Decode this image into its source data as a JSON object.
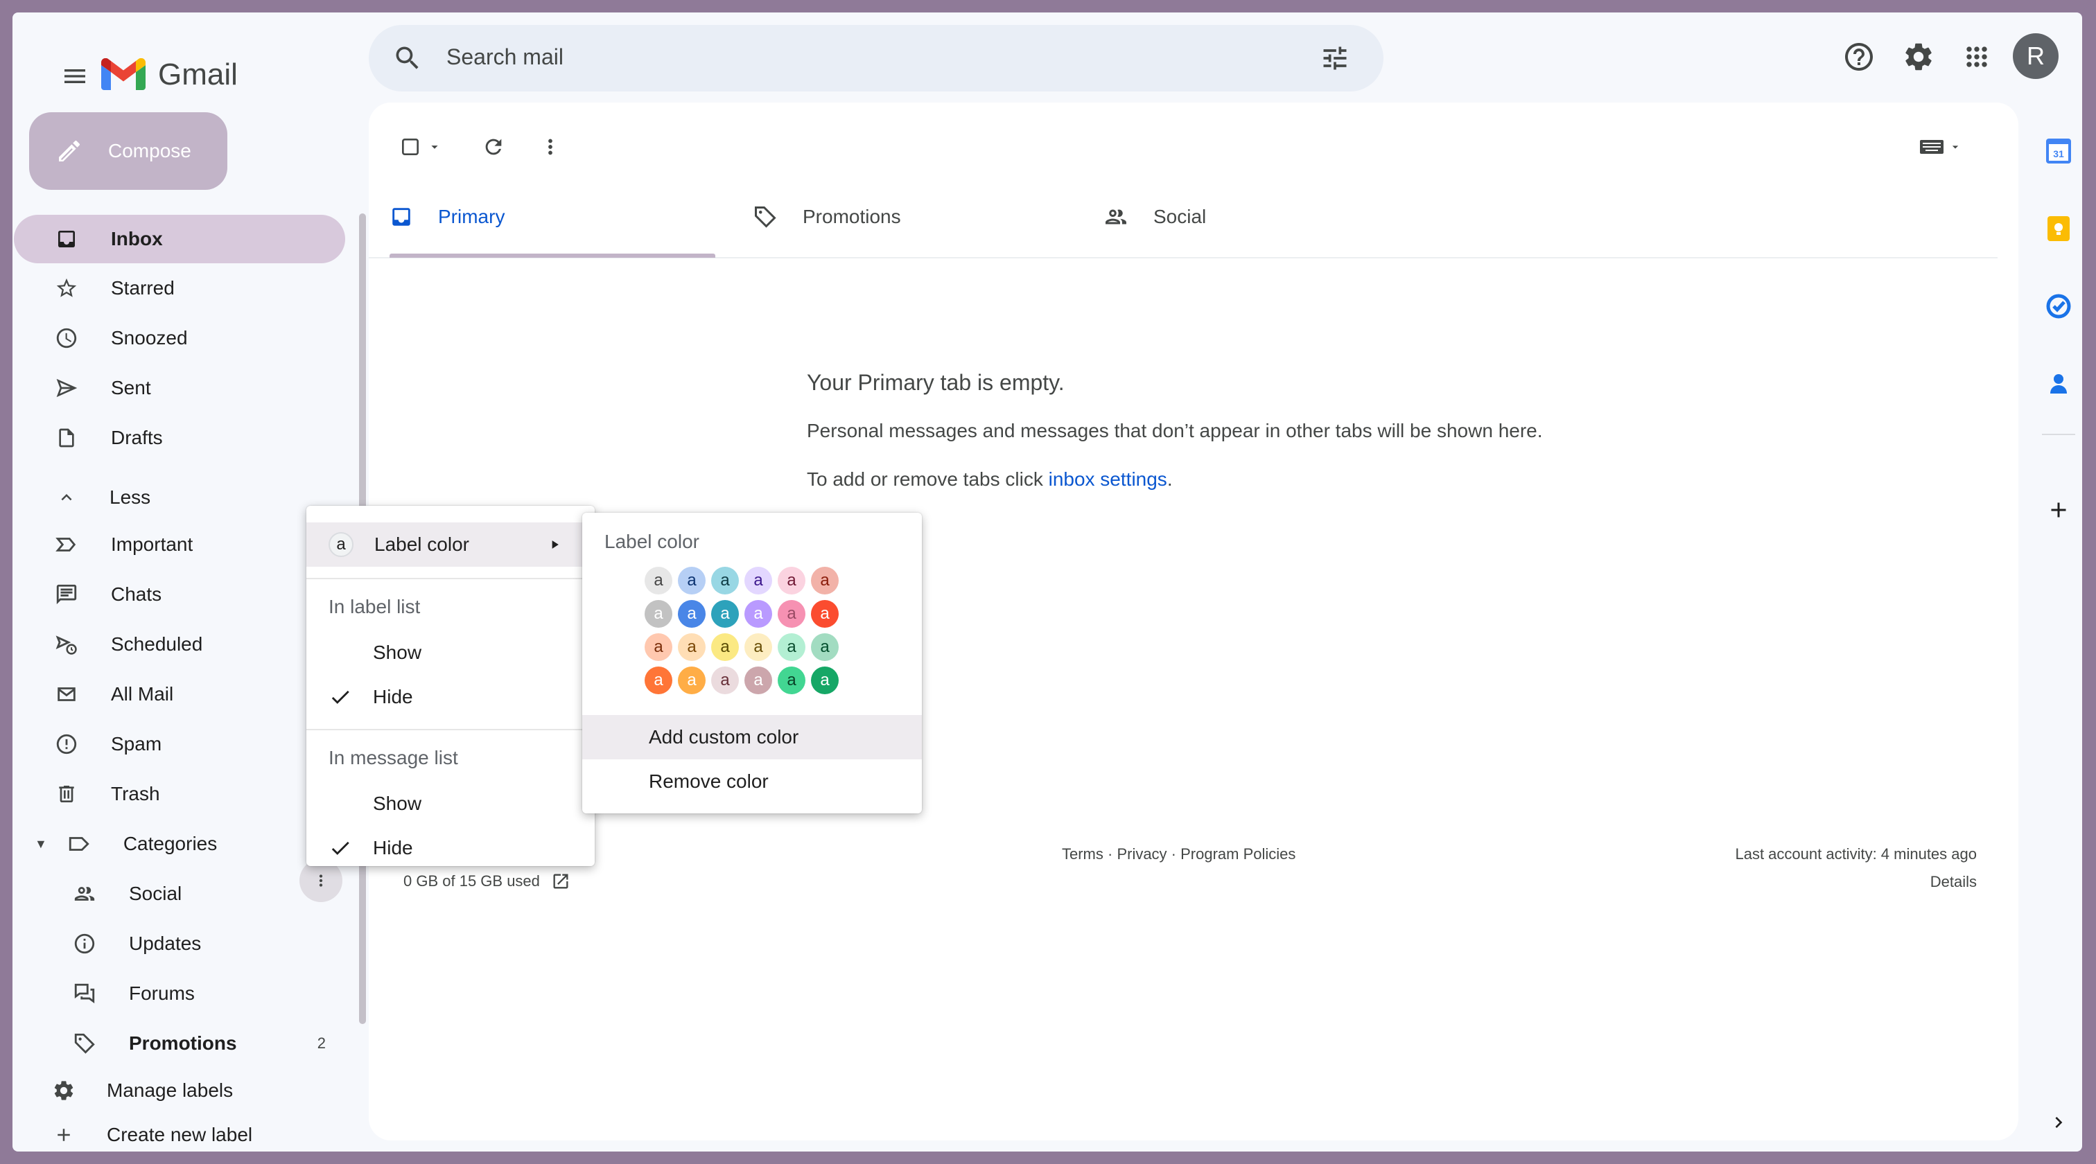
{
  "app": {
    "name": "Gmail",
    "avatar_initial": "R"
  },
  "search": {
    "placeholder": "Search mail"
  },
  "compose": {
    "label": "Compose"
  },
  "sidebar": {
    "items": [
      {
        "label": "Inbox",
        "icon": "inbox-icon",
        "active": true
      },
      {
        "label": "Starred",
        "icon": "star-icon"
      },
      {
        "label": "Snoozed",
        "icon": "clock-icon"
      },
      {
        "label": "Sent",
        "icon": "send-icon"
      },
      {
        "label": "Drafts",
        "icon": "draft-icon"
      },
      {
        "label": "Less",
        "icon": "chevron-up-icon"
      },
      {
        "label": "Important",
        "icon": "important-icon"
      },
      {
        "label": "Chats",
        "icon": "chat-icon"
      },
      {
        "label": "Scheduled",
        "icon": "scheduled-send-icon"
      },
      {
        "label": "All Mail",
        "icon": "all-mail-icon"
      },
      {
        "label": "Spam",
        "icon": "spam-icon"
      },
      {
        "label": "Trash",
        "icon": "trash-icon"
      },
      {
        "label": "Categories",
        "icon": "label-icon"
      },
      {
        "label": "Social",
        "icon": "people-icon"
      },
      {
        "label": "Updates",
        "icon": "info-icon"
      },
      {
        "label": "Forums",
        "icon": "forum-icon"
      },
      {
        "label": "Promotions",
        "icon": "tag-icon",
        "count": "2"
      },
      {
        "label": "Manage labels",
        "icon": "gear-icon"
      },
      {
        "label": "Create new label",
        "icon": "plus-icon"
      }
    ]
  },
  "tabs": [
    {
      "label": "Primary",
      "icon": "inbox-icon",
      "active": true
    },
    {
      "label": "Promotions",
      "icon": "tag-icon"
    },
    {
      "label": "Social",
      "icon": "people-icon"
    }
  ],
  "empty_state": {
    "title": "Your Primary tab is empty.",
    "description": "Personal messages and messages that don’t appear in other tabs will be shown here.",
    "link_prefix": "To add or remove tabs click ",
    "link_text": "inbox settings",
    "link_suffix": "."
  },
  "footer": {
    "storage": "0 GB of 15 GB used",
    "links": "Terms · Privacy · Program Policies",
    "activity": "Last account activity: 4 minutes ago",
    "details": "Details"
  },
  "context_menu": {
    "label_color": "Label color",
    "chip_letter": "a",
    "in_label_list": "In label list",
    "show_1": "Show",
    "hide_1": "Hide",
    "in_message_list": "In message list",
    "show_2": "Show",
    "hide_2": "Hide"
  },
  "color_submenu": {
    "title": "Label color",
    "swatch_letter": "a",
    "swatches": [
      [
        "#e7e7e7",
        "#464646"
      ],
      [
        "#b6cff5",
        "#0d3472"
      ],
      [
        "#98d7e4",
        "#0d3b44"
      ],
      [
        "#e3d7ff",
        "#3d188e"
      ],
      [
        "#fbd3e0",
        "#711a36"
      ],
      [
        "#f2b2a8",
        "#8a1c0a"
      ],
      [
        "#c2c2c2",
        "#ffffff"
      ],
      [
        "#4986e7",
        "#ffffff"
      ],
      [
        "#2da2bb",
        "#ffffff"
      ],
      [
        "#b99aff",
        "#ffffff"
      ],
      [
        "#f691b2",
        "#994a64"
      ],
      [
        "#fb4c2f",
        "#ffffff"
      ],
      [
        "#ffc8af",
        "#7a2e0b"
      ],
      [
        "#ffdeb5",
        "#7a4706"
      ],
      [
        "#fbe983",
        "#594c05"
      ],
      [
        "#fdedc1",
        "#684e07"
      ],
      [
        "#b3efd3",
        "#0b4f30"
      ],
      [
        "#a2dcc1",
        "#04502e"
      ],
      [
        "#ff7537",
        "#ffffff"
      ],
      [
        "#ffad46",
        "#ffffff"
      ],
      [
        "#ebdbde",
        "#662e37"
      ],
      [
        "#cca6ac",
        "#ffffff"
      ],
      [
        "#42d692",
        "#094228"
      ],
      [
        "#16a766",
        "#ffffff"
      ]
    ],
    "add_custom": "Add custom color",
    "remove": "Remove color"
  },
  "colors": {
    "accent": "#0b57d0",
    "compose_bg": "#c2b4c8",
    "active_nav": "#d8c9dc"
  }
}
